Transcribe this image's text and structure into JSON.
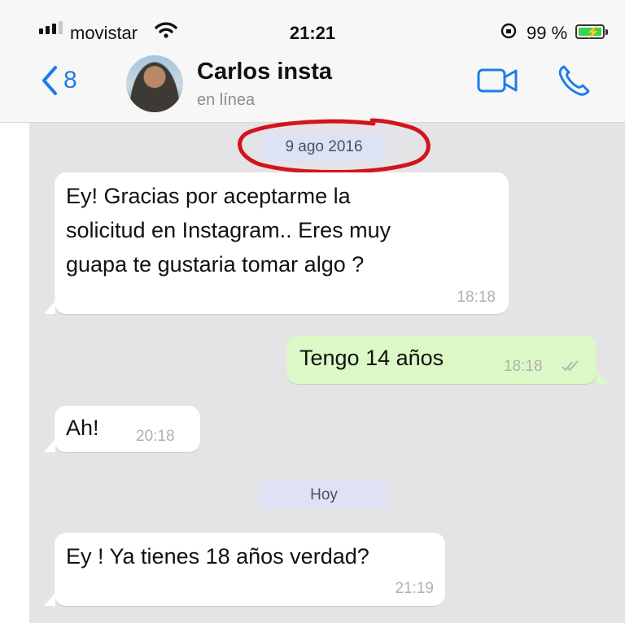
{
  "status_bar": {
    "carrier": "movistar",
    "time": "21:21",
    "battery_percent": "99 %",
    "battery_level": 0.99
  },
  "header": {
    "back_count": "8",
    "contact_name": "Carlos insta",
    "contact_status": "en línea"
  },
  "messages": [
    {
      "type": "date",
      "label": "9 ago 2016"
    },
    {
      "type": "incoming",
      "text": "Ey! Gracias por aceptarme la\nsolicitud en Instagram.. Eres muy\nguapa te gustaria tomar algo ?",
      "time": "18:18"
    },
    {
      "type": "outgoing",
      "text": "Tengo 14 años",
      "time": "18:18",
      "status": "read"
    },
    {
      "type": "incoming",
      "text": "Ah!",
      "time": "20:18"
    },
    {
      "type": "date",
      "label": "Hoy"
    },
    {
      "type": "incoming",
      "text": "Ey ! Ya tienes 18 años verdad?",
      "time": "21:19"
    }
  ],
  "colors": {
    "accent": "#1d7ce8",
    "chat_background": "#e4e4e7",
    "incoming_bubble": "#ffffff",
    "outgoing_bubble": "#dcf8c6",
    "date_pill": "#dde3f4",
    "annotation_circle": "#d3141e"
  },
  "icons": {
    "back": "chevron-left-icon",
    "video_call": "video-camera-icon",
    "voice_call": "phone-icon",
    "wifi": "wifi-icon",
    "signal": "cellular-signal-icon",
    "rotation_lock": "rotation-lock-icon",
    "battery": "battery-charging-icon"
  }
}
